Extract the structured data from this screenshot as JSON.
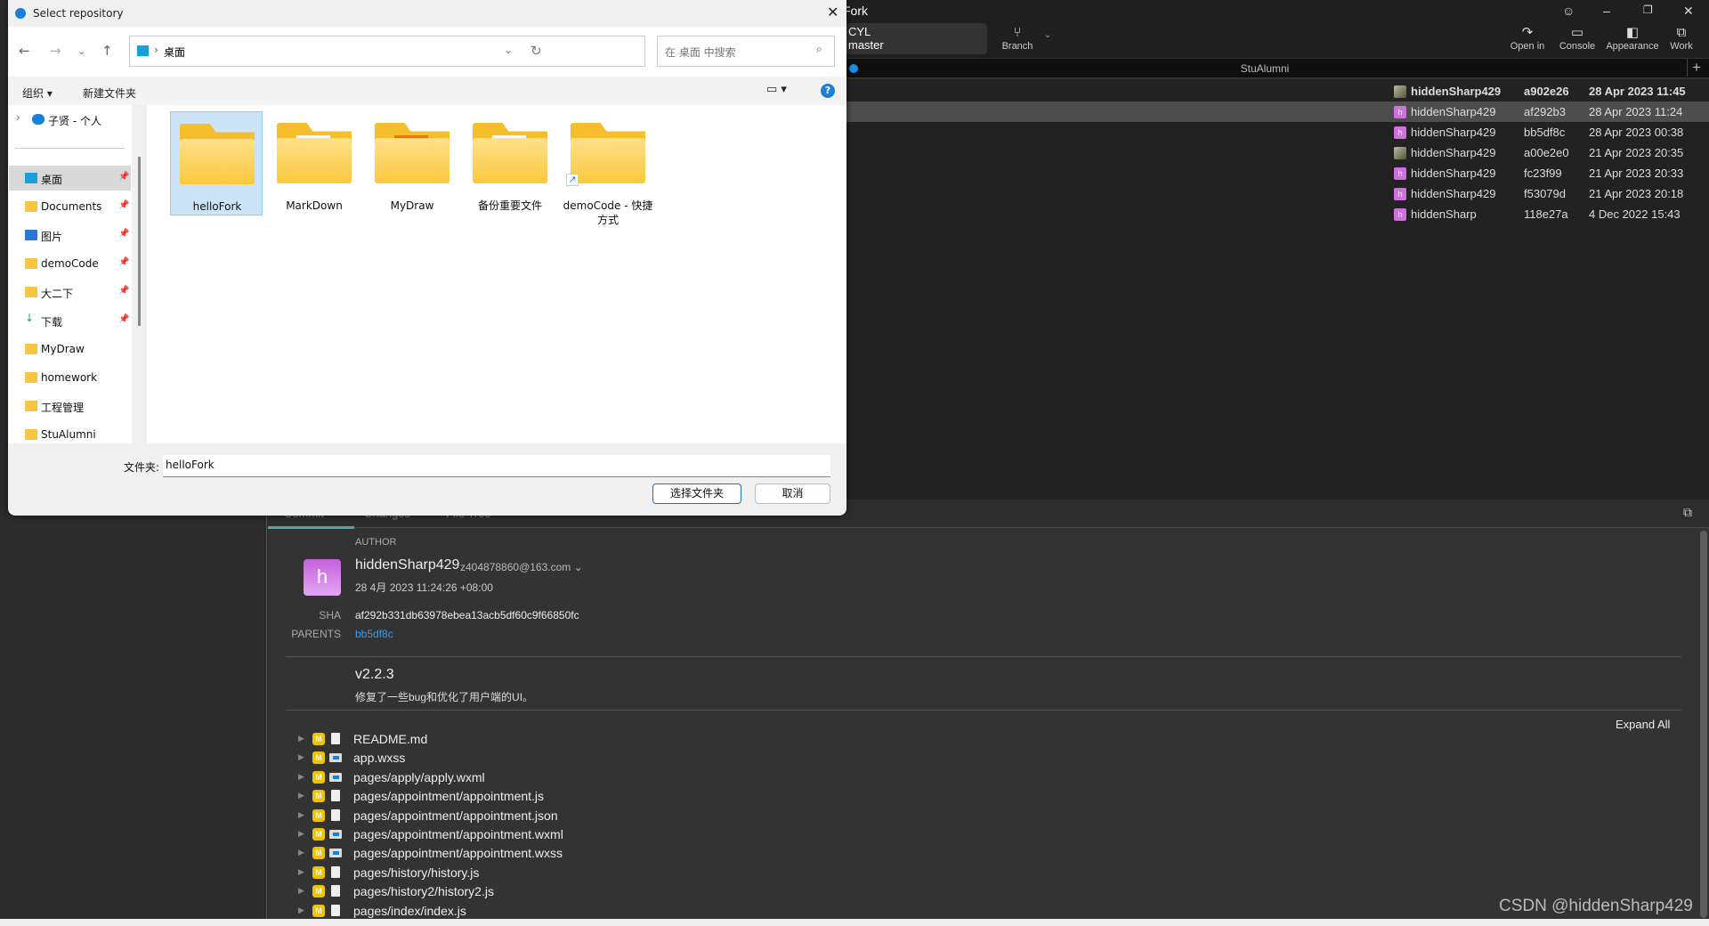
{
  "fork": {
    "title": "Fork",
    "repo": {
      "name": "CYL",
      "branch": "master"
    },
    "toolbar": {
      "branch": "Branch",
      "open_in": "Open in",
      "console": "Console",
      "appearance": "Appearance",
      "work": "Work"
    },
    "window_controls": {
      "feedback": "☺",
      "minimize": "–",
      "maximize": "❐",
      "close": "✕"
    },
    "repo_tab": "StuAlumni",
    "add_tab": "+",
    "commits": [
      {
        "author": "hiddenSharp429",
        "sha": "a902e26",
        "date": "28 Apr 2023 11:45",
        "avatar": "photo",
        "bold": true
      },
      {
        "author": "hiddenSharp429",
        "sha": "af292b3",
        "date": "28 Apr 2023 11:24",
        "avatar": "h",
        "selected": true
      },
      {
        "author": "hiddenSharp429",
        "sha": "bb5df8c",
        "date": "28 Apr 2023 00:38",
        "avatar": "h"
      },
      {
        "author": "hiddenSharp429",
        "sha": "a00e2e0",
        "date": "21 Apr 2023 20:35",
        "avatar": "photo"
      },
      {
        "author": "hiddenSharp429",
        "sha": "fc23f99",
        "date": "21 Apr 2023 20:33",
        "avatar": "h"
      },
      {
        "author": "hiddenSharp429",
        "sha": "f53079d",
        "date": "21 Apr 2023 20:18",
        "avatar": "h"
      },
      {
        "author": "hiddenSharp",
        "sha": "118e27a",
        "date": "4 Dec 2022 15:43",
        "avatar": "h"
      }
    ],
    "detail": {
      "tabs": [
        "Commit",
        "Changes",
        "File Tree"
      ],
      "author_label": "AUTHOR",
      "avatar_letter": "h",
      "author_name": "hiddenSharp429",
      "author_email": "z404878860@163.com",
      "date": "28 4月 2023 11:24:26 +08:00",
      "sha_label": "SHA",
      "sha": "af292b331db63978ebea13acb5df60c9f66850fc",
      "parents_label": "PARENTS",
      "parent": "bb5df8c",
      "subject": "v2.2.3",
      "message": "修复了一些bug和优化了用户端的UI。",
      "expand_all": "Expand All",
      "files": [
        {
          "status": "M",
          "type": "md",
          "name": "README.md"
        },
        {
          "status": "M",
          "type": "wx",
          "name": "app.wxss"
        },
        {
          "status": "M",
          "type": "wx",
          "name": "pages/apply/apply.wxml"
        },
        {
          "status": "M",
          "type": "js",
          "name": "pages/appointment/appointment.js"
        },
        {
          "status": "M",
          "type": "json",
          "name": "pages/appointment/appointment.json"
        },
        {
          "status": "M",
          "type": "wx",
          "name": "pages/appointment/appointment.wxml"
        },
        {
          "status": "M",
          "type": "wx",
          "name": "pages/appointment/appointment.wxss"
        },
        {
          "status": "M",
          "type": "js",
          "name": "pages/history/history.js"
        },
        {
          "status": "M",
          "type": "js",
          "name": "pages/history2/history2.js"
        },
        {
          "status": "M",
          "type": "js",
          "name": "pages/index/index.js"
        }
      ]
    },
    "watermark": "CSDN @hiddenSharp429",
    "colors": {
      "accent_teal": "#4fa8a8",
      "link": "#3d9be9",
      "status_modified": "#f2c200",
      "avatar": "#d070e0"
    }
  },
  "dialog": {
    "title": "Select repository",
    "address": "桌面",
    "search_placeholder": "在 桌面 中搜索",
    "organize": "组织 ▾",
    "new_folder": "新建文件夹",
    "sidebar": [
      {
        "label": "子贤 - 个人",
        "icon": "onedrive"
      },
      {
        "label": "桌面",
        "icon": "desktop",
        "selected": true,
        "pinned": true
      },
      {
        "label": "Documents",
        "icon": "folder",
        "pinned": true
      },
      {
        "label": "图片",
        "icon": "pictures",
        "pinned": true
      },
      {
        "label": "demoCode",
        "icon": "folder",
        "pinned": true
      },
      {
        "label": "大二下",
        "icon": "folder",
        "pinned": true
      },
      {
        "label": "下载",
        "icon": "download",
        "pinned": true
      },
      {
        "label": "MyDraw",
        "icon": "folder"
      },
      {
        "label": "homework",
        "icon": "folder"
      },
      {
        "label": "工程管理",
        "icon": "folder"
      },
      {
        "label": "StuAlumni",
        "icon": "folder"
      }
    ],
    "items": [
      {
        "name": "helloFork",
        "selected": true,
        "content": "empty"
      },
      {
        "name": "MarkDown",
        "content": "doc"
      },
      {
        "name": "MyDraw",
        "content": "app"
      },
      {
        "name": "备份重要文件",
        "content": "doc"
      },
      {
        "name": "demoCode - 快捷方式",
        "content": "shortcut"
      }
    ],
    "folder_label": "文件夹:",
    "folder_value": "helloFork",
    "select_button": "选择文件夹",
    "cancel_button": "取消"
  }
}
